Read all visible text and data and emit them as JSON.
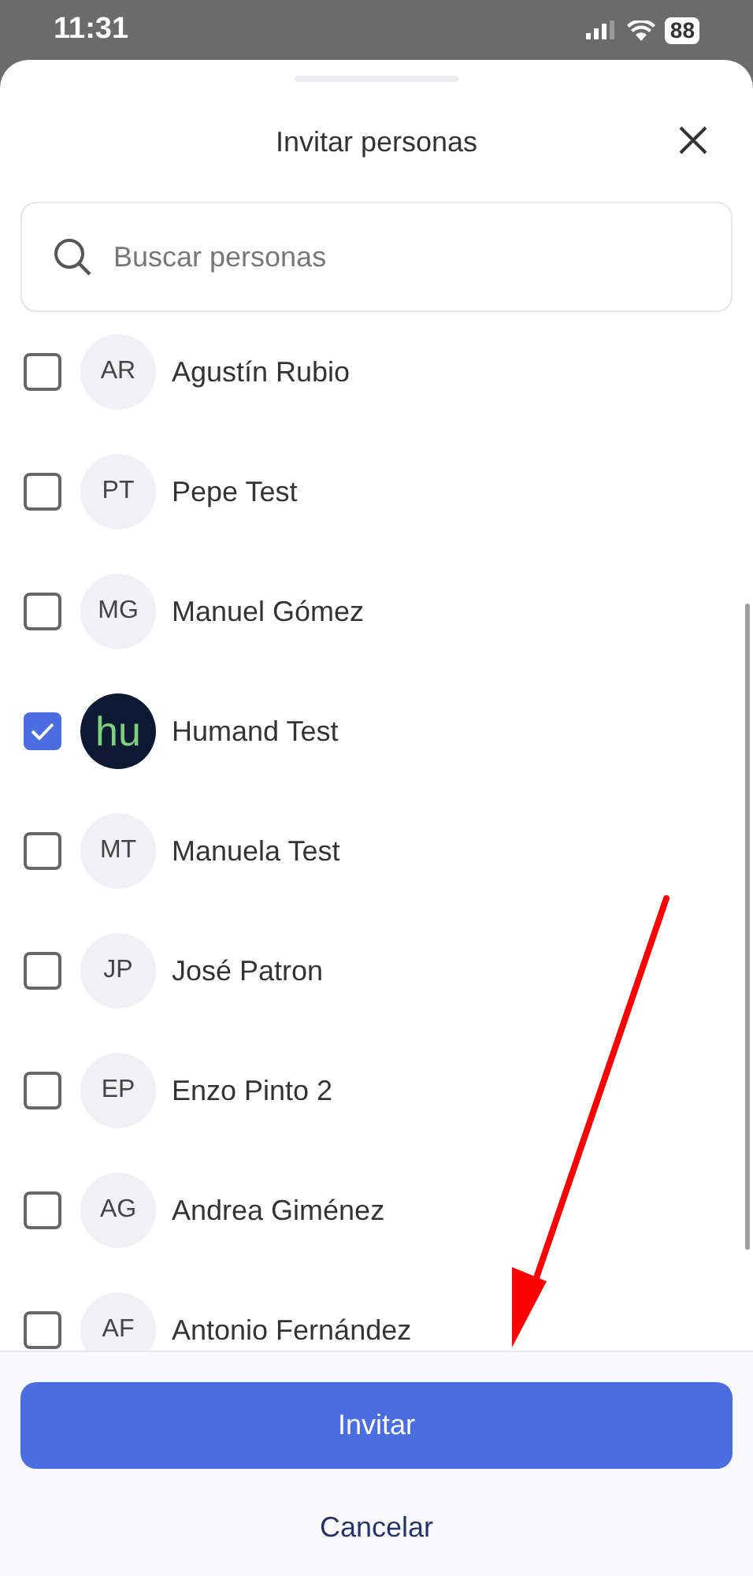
{
  "status_bar": {
    "time": "11:31",
    "battery": "88"
  },
  "sheet": {
    "title": "Invitar personas"
  },
  "search": {
    "placeholder": "Buscar personas"
  },
  "people": [
    {
      "initials": "AR",
      "name": "Agustín Rubio",
      "checked": false,
      "kind": "initials"
    },
    {
      "initials": "PT",
      "name": "Pepe Test",
      "checked": false,
      "kind": "initials"
    },
    {
      "initials": "MG",
      "name": "Manuel Gómez",
      "checked": false,
      "kind": "initials"
    },
    {
      "initials": "hu",
      "name": "Humand Test",
      "checked": true,
      "kind": "logo"
    },
    {
      "initials": "MT",
      "name": "Manuela Test",
      "checked": false,
      "kind": "initials"
    },
    {
      "initials": "JP",
      "name": "José Patron",
      "checked": false,
      "kind": "initials"
    },
    {
      "initials": "EP",
      "name": "Enzo Pinto 2",
      "checked": false,
      "kind": "initials"
    },
    {
      "initials": "AG",
      "name": "Andrea Giménez",
      "checked": false,
      "kind": "initials"
    },
    {
      "initials": "AF",
      "name": "Antonio Fernández",
      "checked": false,
      "kind": "initials"
    }
  ],
  "buttons": {
    "primary": "Invitar",
    "secondary": "Cancelar"
  }
}
